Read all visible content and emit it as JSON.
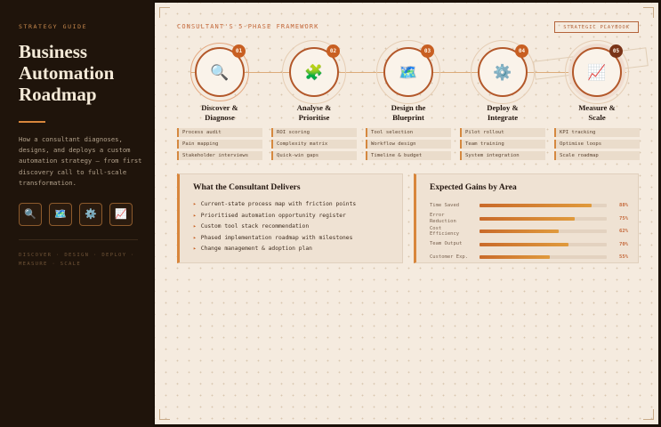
{
  "sidebar": {
    "kicker": "STRATEGY GUIDE",
    "title_lines": [
      "Business",
      "Automation",
      "Roadmap"
    ],
    "description": "How a consultant diagnoses, designs, and deploys a custom automation strategy — from first discovery call to full-scale transformation.",
    "icons": [
      {
        "name": "magnifier-icon",
        "glyph": "🔍"
      },
      {
        "name": "map-icon",
        "glyph": "🗺️"
      },
      {
        "name": "gear-icon",
        "glyph": "⚙️"
      },
      {
        "name": "chart-icon",
        "glyph": "📈"
      }
    ],
    "footer": "DISCOVER · DESIGN · DEPLOY · MEASURE · SCALE"
  },
  "main": {
    "framework_label": "CONSULTANT'S 5-PHASE FRAMEWORK",
    "playbook_label": "STRATEGIC PLAYBOOK",
    "stamp_text": "5-PHASE",
    "phases": [
      {
        "number": "01",
        "icon": "magnifier-icon",
        "glyph": "🔍",
        "title": [
          "Discover &",
          "Diagnose"
        ],
        "tasks": [
          "Process audit",
          "Pain mapping",
          "Stakeholder interviews"
        ]
      },
      {
        "number": "02",
        "icon": "puzzle-icon",
        "glyph": "🧩",
        "title": [
          "Analyse &",
          "Prioritise"
        ],
        "tasks": [
          "ROI scoring",
          "Complexity matrix",
          "Quick-win gaps"
        ]
      },
      {
        "number": "03",
        "icon": "map-icon",
        "glyph": "🗺️",
        "title": [
          "Design the",
          "Blueprint"
        ],
        "tasks": [
          "Tool selection",
          "Workflow design",
          "Timeline & budget"
        ]
      },
      {
        "number": "04",
        "icon": "gear-icon",
        "glyph": "⚙️",
        "title": [
          "Deploy &",
          "Integrate"
        ],
        "tasks": [
          "Pilot rollout",
          "Team training",
          "System integration"
        ]
      },
      {
        "number": "05",
        "icon": "chart-icon",
        "glyph": "📈",
        "title": [
          "Measure &",
          "Scale"
        ],
        "tasks": [
          "KPI tracking",
          "Optimise loops",
          "Scale roadmap"
        ]
      }
    ],
    "deliverables": {
      "title": "What the Consultant Delivers",
      "items": [
        "Current-state process map with friction points",
        "Prioritised automation opportunity register",
        "Custom tool stack recommendation",
        "Phased implementation roadmap with milestones",
        "Change management & adoption plan"
      ]
    },
    "gains": {
      "title": "Expected Gains by Area",
      "rows": [
        {
          "label": [
            "Time Saved"
          ],
          "value": 88,
          "display": "88%"
        },
        {
          "label": [
            "Error",
            "Reduction"
          ],
          "value": 75,
          "display": "75%"
        },
        {
          "label": [
            "Cost",
            "Efficiency"
          ],
          "value": 62,
          "display": "62%"
        },
        {
          "label": [
            "Team Output"
          ],
          "value": 70,
          "display": "70%"
        },
        {
          "label": [
            "Customer Exp."
          ],
          "value": 55,
          "display": "55%"
        }
      ]
    }
  }
}
